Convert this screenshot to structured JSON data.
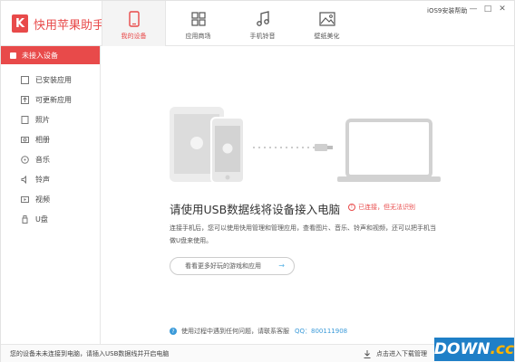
{
  "app": {
    "logo_letter": "K",
    "title": "快用苹果助手"
  },
  "tabs": [
    {
      "label": "我的设备",
      "icon": "device-icon",
      "active": true
    },
    {
      "label": "应用商场",
      "icon": "apps-grid-icon",
      "active": false
    },
    {
      "label": "手机铃音",
      "icon": "music-note-icon",
      "active": false
    },
    {
      "label": "壁纸美化",
      "icon": "wallpaper-icon",
      "active": false
    }
  ],
  "header": {
    "help_link": "iOS9安装帮助",
    "min": "—",
    "restore": "□",
    "close": "✕"
  },
  "sidebar": {
    "header": "未接入设备",
    "items": [
      {
        "label": "已安装应用",
        "icon": "installed-apps-icon"
      },
      {
        "label": "可更新应用",
        "icon": "update-icon"
      },
      {
        "label": "照片",
        "icon": "photo-icon"
      },
      {
        "label": "相册",
        "icon": "album-icon"
      },
      {
        "label": "音乐",
        "icon": "music-icon"
      },
      {
        "label": "铃声",
        "icon": "bell-icon"
      },
      {
        "label": "视频",
        "icon": "video-icon"
      },
      {
        "label": "U盘",
        "icon": "usb-drive-icon"
      }
    ]
  },
  "main": {
    "headline": "请使用USB数据线将设备接入电脑",
    "hint": "已连接，但无法识别",
    "hint_icon": "!",
    "description": "连接手机后，您可以使用快用管理和管理应用，查看图片、音乐、铃声和视频，还可以把手机当做U盘来使用。",
    "more_button": "看看更多好玩的游戏和应用",
    "more_arrow": "→",
    "support_icon": "?",
    "support_text": "使用过程中遇到任何问题，请联系客服",
    "support_qq": "QQ：800111908"
  },
  "status": {
    "left": "您的设备未未连接到电脑，请插入USB数据线并开启电脑",
    "right": "点击进入下载管理"
  },
  "watermark": {
    "text": "DOWN",
    "suffix": ".cc"
  },
  "colors": {
    "accent": "#e84a4a",
    "link": "#3a9ad9"
  }
}
